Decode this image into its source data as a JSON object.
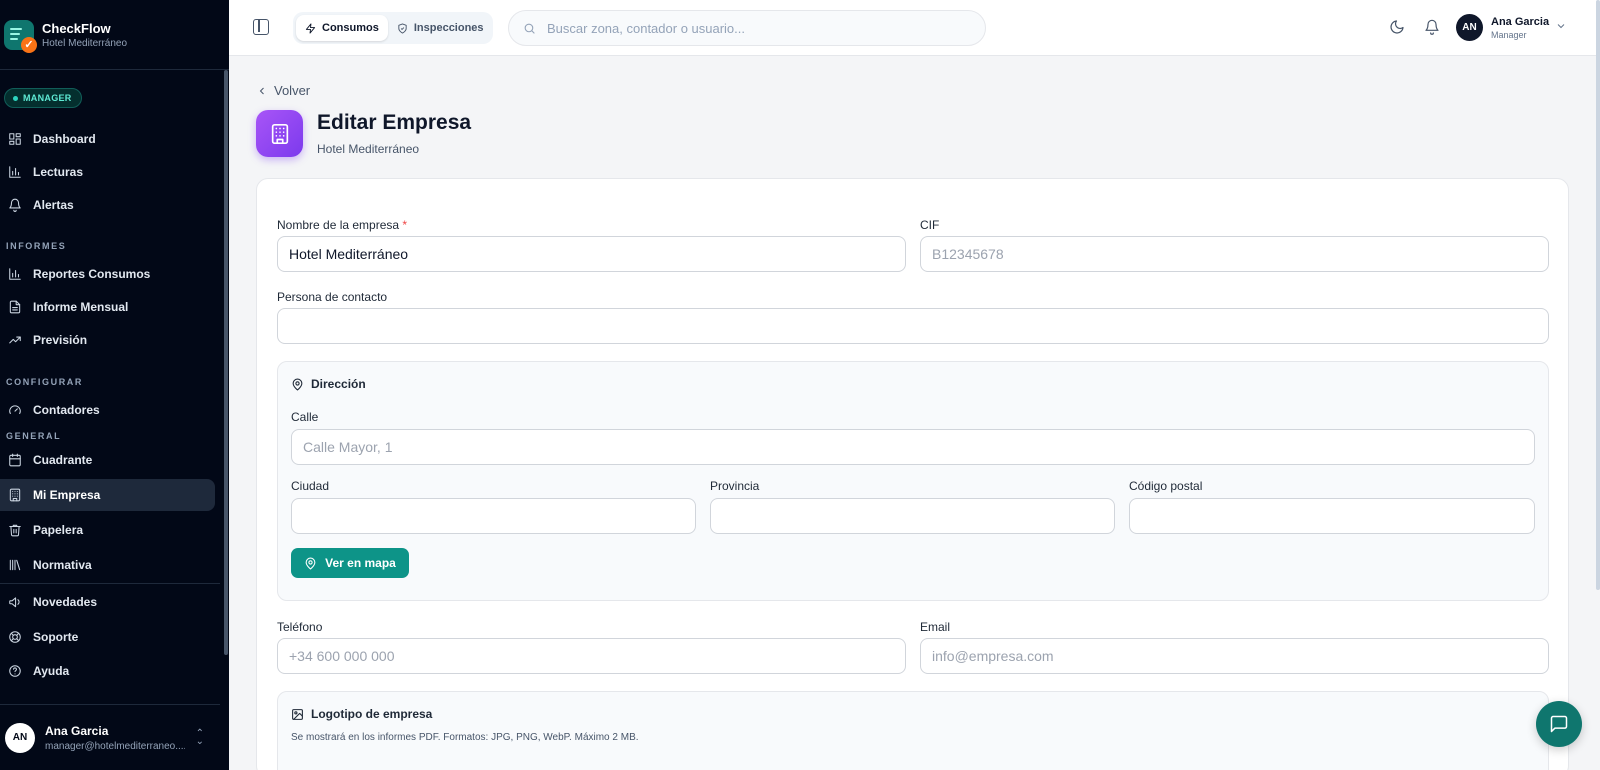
{
  "app": {
    "name": "CheckFlow",
    "subtitle": "Hotel Mediterráneo"
  },
  "sidebar": {
    "role_badge": "MANAGER",
    "items_main": [
      {
        "label": "Dashboard",
        "icon": "dashboard-icon"
      },
      {
        "label": "Lecturas",
        "icon": "bar-chart-icon"
      },
      {
        "label": "Alertas",
        "icon": "bell-icon"
      }
    ],
    "section_informes": "INFORMES",
    "items_informes": [
      {
        "label": "Reportes Consumos",
        "icon": "bar-chart-icon"
      },
      {
        "label": "Informe Mensual",
        "icon": "document-icon"
      },
      {
        "label": "Previsión",
        "icon": "trending-up-icon"
      }
    ],
    "section_configurar": "CONFIGURAR",
    "items_configurar": [
      {
        "label": "Contadores",
        "icon": "gauge-icon"
      }
    ],
    "section_general": "GENERAL",
    "items_general": [
      {
        "label": "Cuadrante",
        "icon": "calendar-icon"
      },
      {
        "label": "Mi Empresa",
        "icon": "building-icon",
        "active": true
      },
      {
        "label": "Papelera",
        "icon": "trash-icon"
      },
      {
        "label": "Normativa",
        "icon": "library-icon"
      }
    ],
    "items_footer": [
      {
        "label": "Novedades",
        "icon": "megaphone-icon"
      },
      {
        "label": "Soporte",
        "icon": "lifebuoy-icon"
      },
      {
        "label": "Ayuda",
        "icon": "help-circle-icon"
      }
    ],
    "user": {
      "initials": "AN",
      "name": "Ana Garcia",
      "email": "manager@hotelmediterraneo...."
    }
  },
  "topbar": {
    "tabs": [
      {
        "label": "Consumos",
        "active": true
      },
      {
        "label": "Inspecciones",
        "active": false
      }
    ],
    "search_placeholder": "Buscar zona, contador o usuario...",
    "user": {
      "initials": "AN",
      "name": "Ana Garcia",
      "role": "Manager"
    }
  },
  "page": {
    "back_label": "Volver",
    "title": "Editar Empresa",
    "subtitle": "Hotel Mediterráneo"
  },
  "form": {
    "nombre": {
      "label": "Nombre de la empresa",
      "required_mark": "*",
      "value": "Hotel Mediterráneo"
    },
    "cif": {
      "label": "CIF",
      "placeholder": "B12345678"
    },
    "contacto": {
      "label": "Persona de contacto",
      "value": ""
    },
    "direccion": {
      "title": "Dirección",
      "calle": {
        "label": "Calle",
        "placeholder": "Calle Mayor, 1"
      },
      "ciudad": {
        "label": "Ciudad",
        "value": ""
      },
      "provincia": {
        "label": "Provincia",
        "value": ""
      },
      "cp": {
        "label": "Código postal",
        "value": ""
      },
      "map_button": "Ver en mapa"
    },
    "telefono": {
      "label": "Teléfono",
      "placeholder": "+34 600 000 000"
    },
    "email": {
      "label": "Email",
      "placeholder": "info@empresa.com"
    },
    "logo": {
      "title": "Logotipo de empresa",
      "hint": "Se mostrará en los informes PDF. Formatos: JPG, PNG, WebP. Máximo 2 MB."
    }
  },
  "colors": {
    "accent": "#0d9488",
    "sidebar_bg": "#020817",
    "page_icon": "#9333ea",
    "required": "#ef4444"
  }
}
